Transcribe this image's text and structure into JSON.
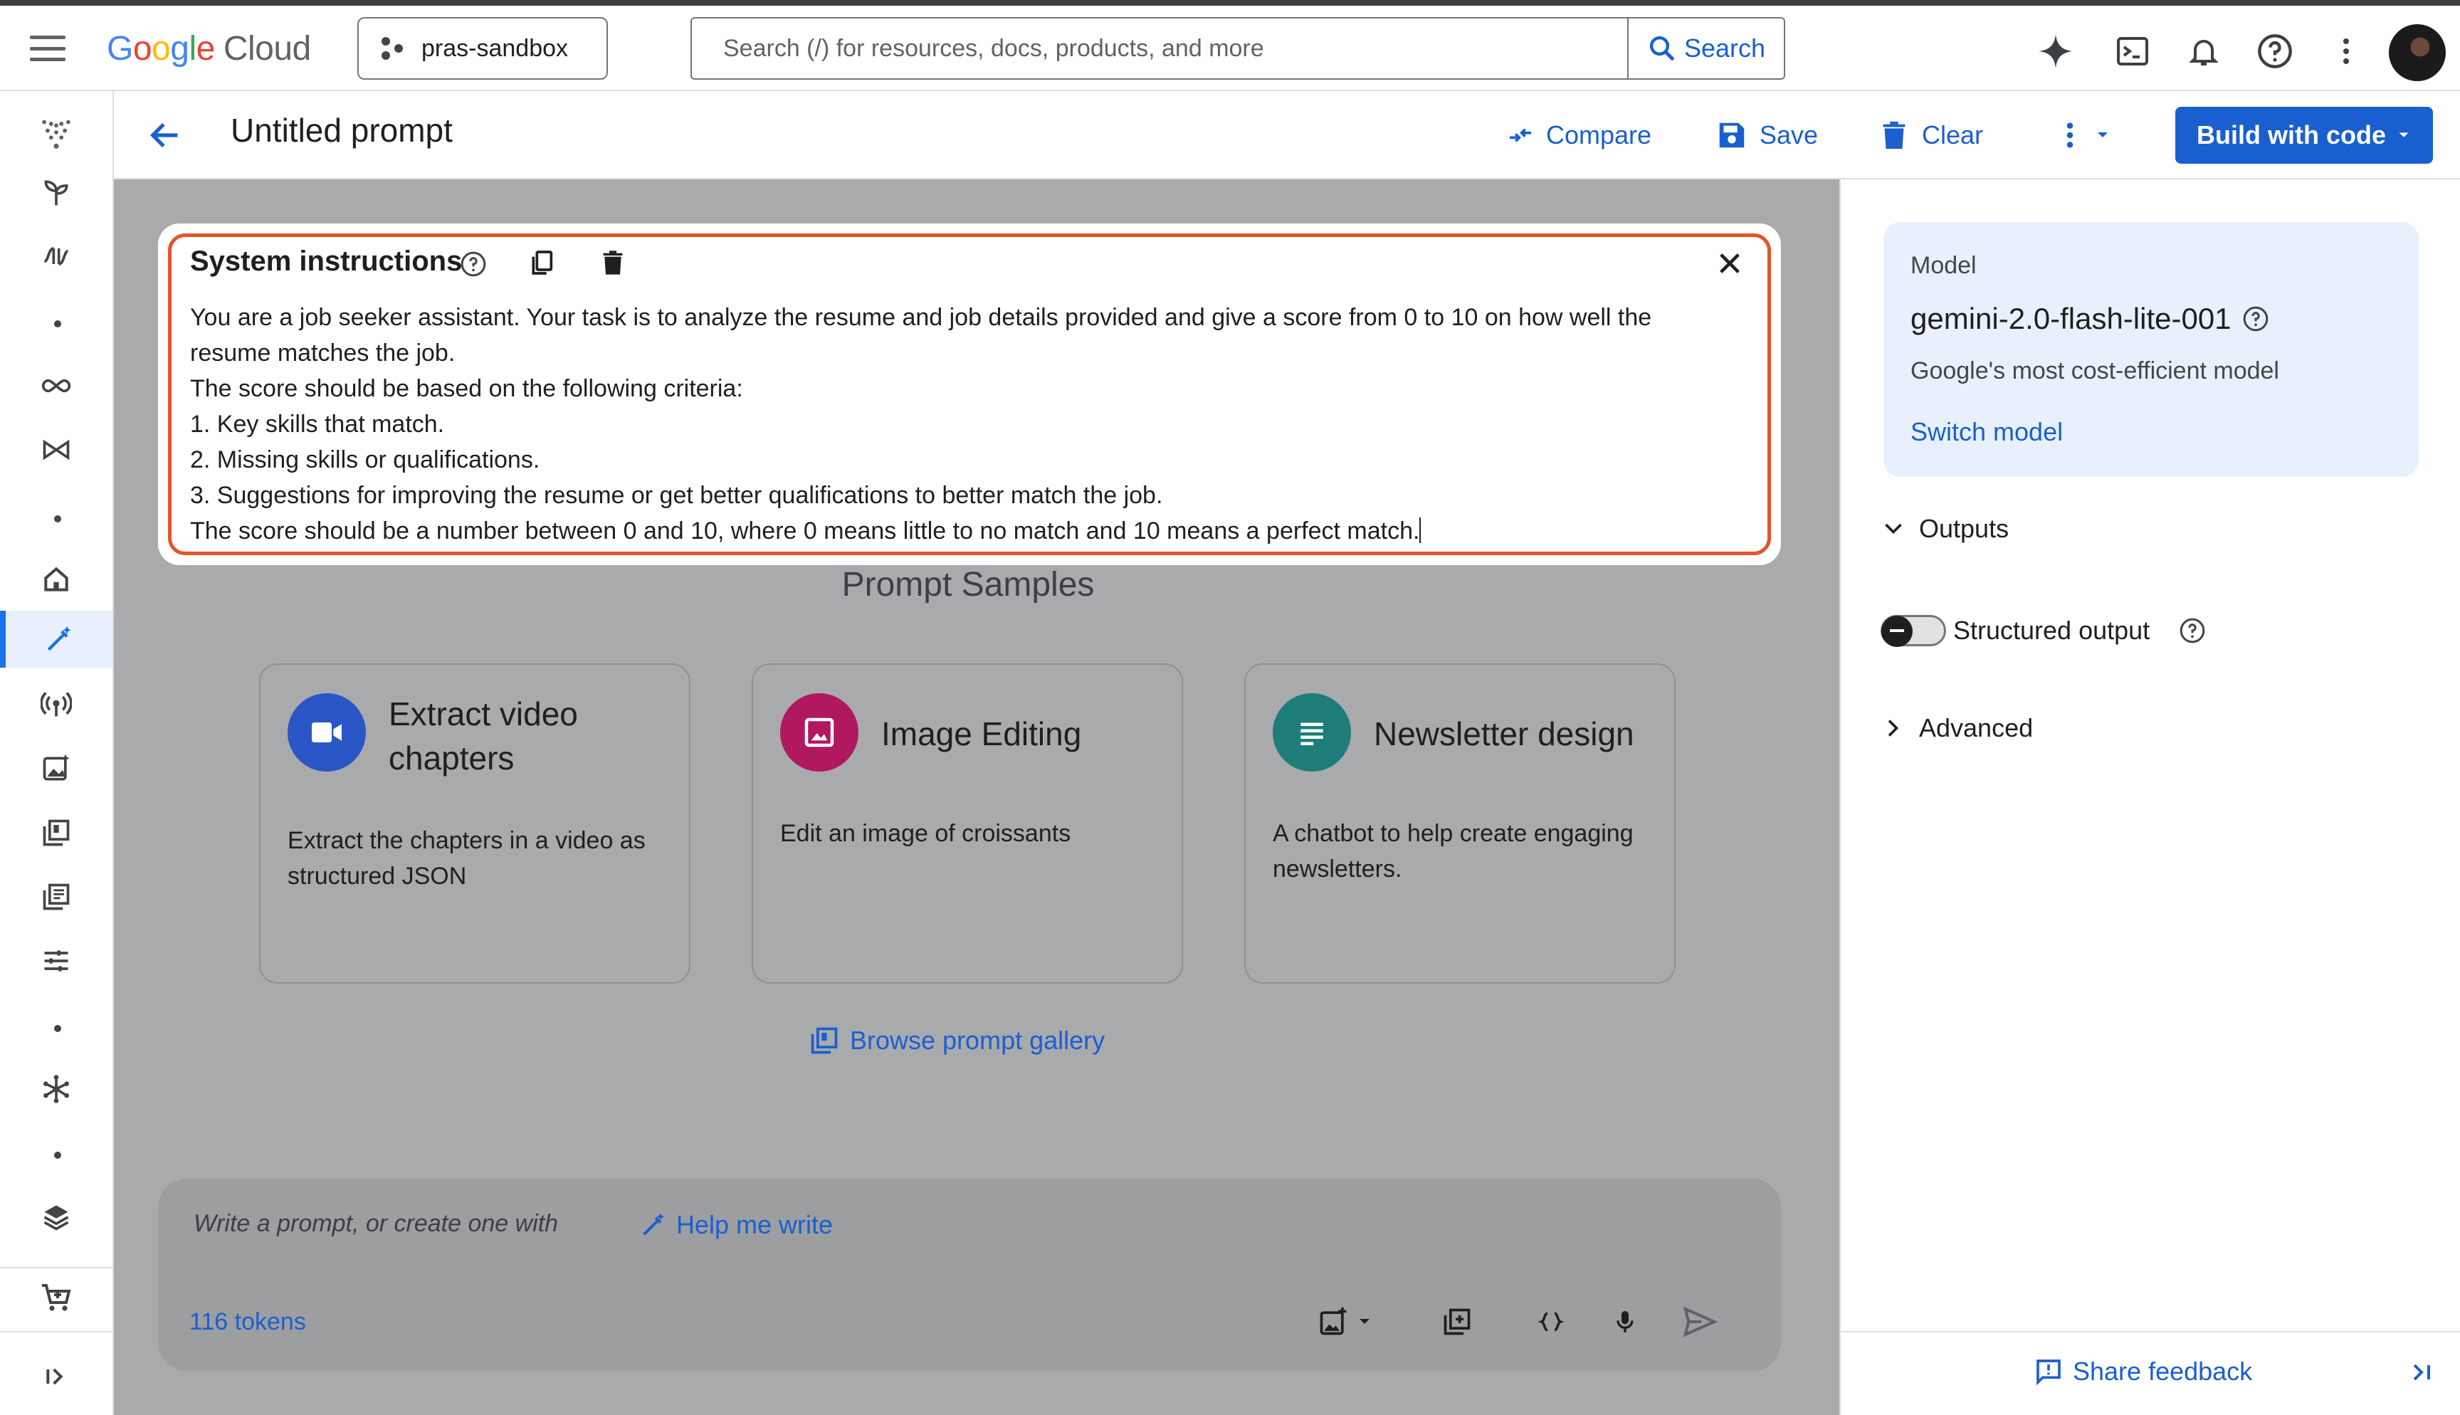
{
  "topbar": {
    "logo_google": [
      "G",
      "o",
      "o",
      "g",
      "l",
      "e"
    ],
    "logo_cloud": "Cloud",
    "project": "pras-sandbox",
    "search_placeholder": "Search (/) for resources, docs, products, and more",
    "search_button": "Search"
  },
  "header": {
    "title": "Untitled prompt",
    "compare": "Compare",
    "save": "Save",
    "clear": "Clear",
    "build": "Build with code"
  },
  "system_instructions": {
    "title": "System instructions",
    "lines": [
      "You are a job seeker assistant. Your task is to analyze the resume and job details provided and give a score from 0 to 10 on how well the",
      "resume matches the job.",
      "The score should be based on the following criteria:",
      "1. Key skills that match.",
      "2. Missing skills or qualifications.",
      "3. Suggestions for improving the resume or get better qualifications to better match the job.",
      "The score should be a number between 0 and 10, where 0 means little to no match and 10 means a perfect match."
    ]
  },
  "samples": {
    "title": "Prompt Samples",
    "cards": [
      {
        "title": "Extract video chapters",
        "desc": "Extract the chapters in a video as structured JSON",
        "icon": "video-icon",
        "color": "#2a56c6"
      },
      {
        "title": "Image Editing",
        "desc": "Edit an image of croissants",
        "icon": "image-icon",
        "color": "#b0185f"
      },
      {
        "title": "Newsletter design",
        "desc": "A chatbot to help create engaging newsletters.",
        "icon": "notes-icon",
        "color": "#1e7d79"
      }
    ],
    "browse": "Browse prompt gallery"
  },
  "input": {
    "placeholder": "Write a prompt, or create one with",
    "help_me_write": "Help me write",
    "tokens": "116 tokens"
  },
  "right_panel": {
    "model_label": "Model",
    "model_name": "gemini-2.0-flash-lite-001",
    "model_desc": "Google's most cost-efficient model",
    "switch_model": "Switch model",
    "outputs": "Outputs",
    "structured_output": "Structured output",
    "advanced": "Advanced",
    "share_feedback": "Share feedback"
  }
}
